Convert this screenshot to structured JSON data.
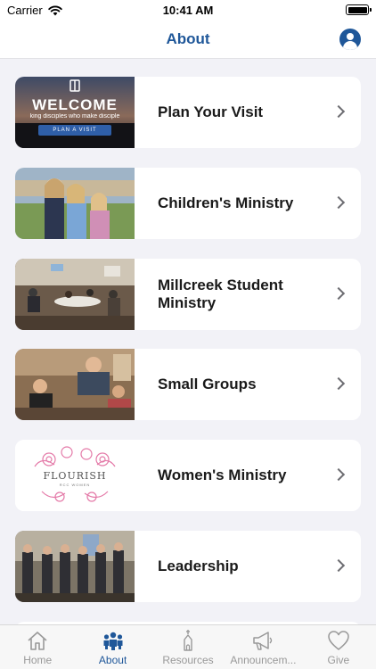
{
  "status_bar": {
    "carrier": "Carrier",
    "time": "10:41 AM"
  },
  "nav": {
    "title": "About"
  },
  "thumb_text": {
    "welcome": "WELCOME",
    "tagline": "king disciples who make disciple",
    "plan_button": "PLAN A VISIT",
    "flourish": "FLOURISH",
    "flourish_sub": "RCC WOMEN"
  },
  "items": [
    {
      "label": "Plan Your Visit"
    },
    {
      "label": "Children's Ministry"
    },
    {
      "label": "Millcreek Student Ministry"
    },
    {
      "label": "Small Groups"
    },
    {
      "label": "Women's Ministry"
    },
    {
      "label": "Leadership"
    }
  ],
  "tabs": [
    {
      "label": "Home",
      "icon": "house-icon",
      "active": false
    },
    {
      "label": "About",
      "icon": "people-icon",
      "active": true
    },
    {
      "label": "Resources",
      "icon": "church-icon",
      "active": false
    },
    {
      "label": "Announcem...",
      "icon": "megaphone-icon",
      "active": false
    },
    {
      "label": "Give",
      "icon": "heart-icon",
      "active": false
    }
  ],
  "colors": {
    "accent": "#1f5799",
    "tab_inactive": "#999999",
    "background": "#f2f2f7"
  }
}
